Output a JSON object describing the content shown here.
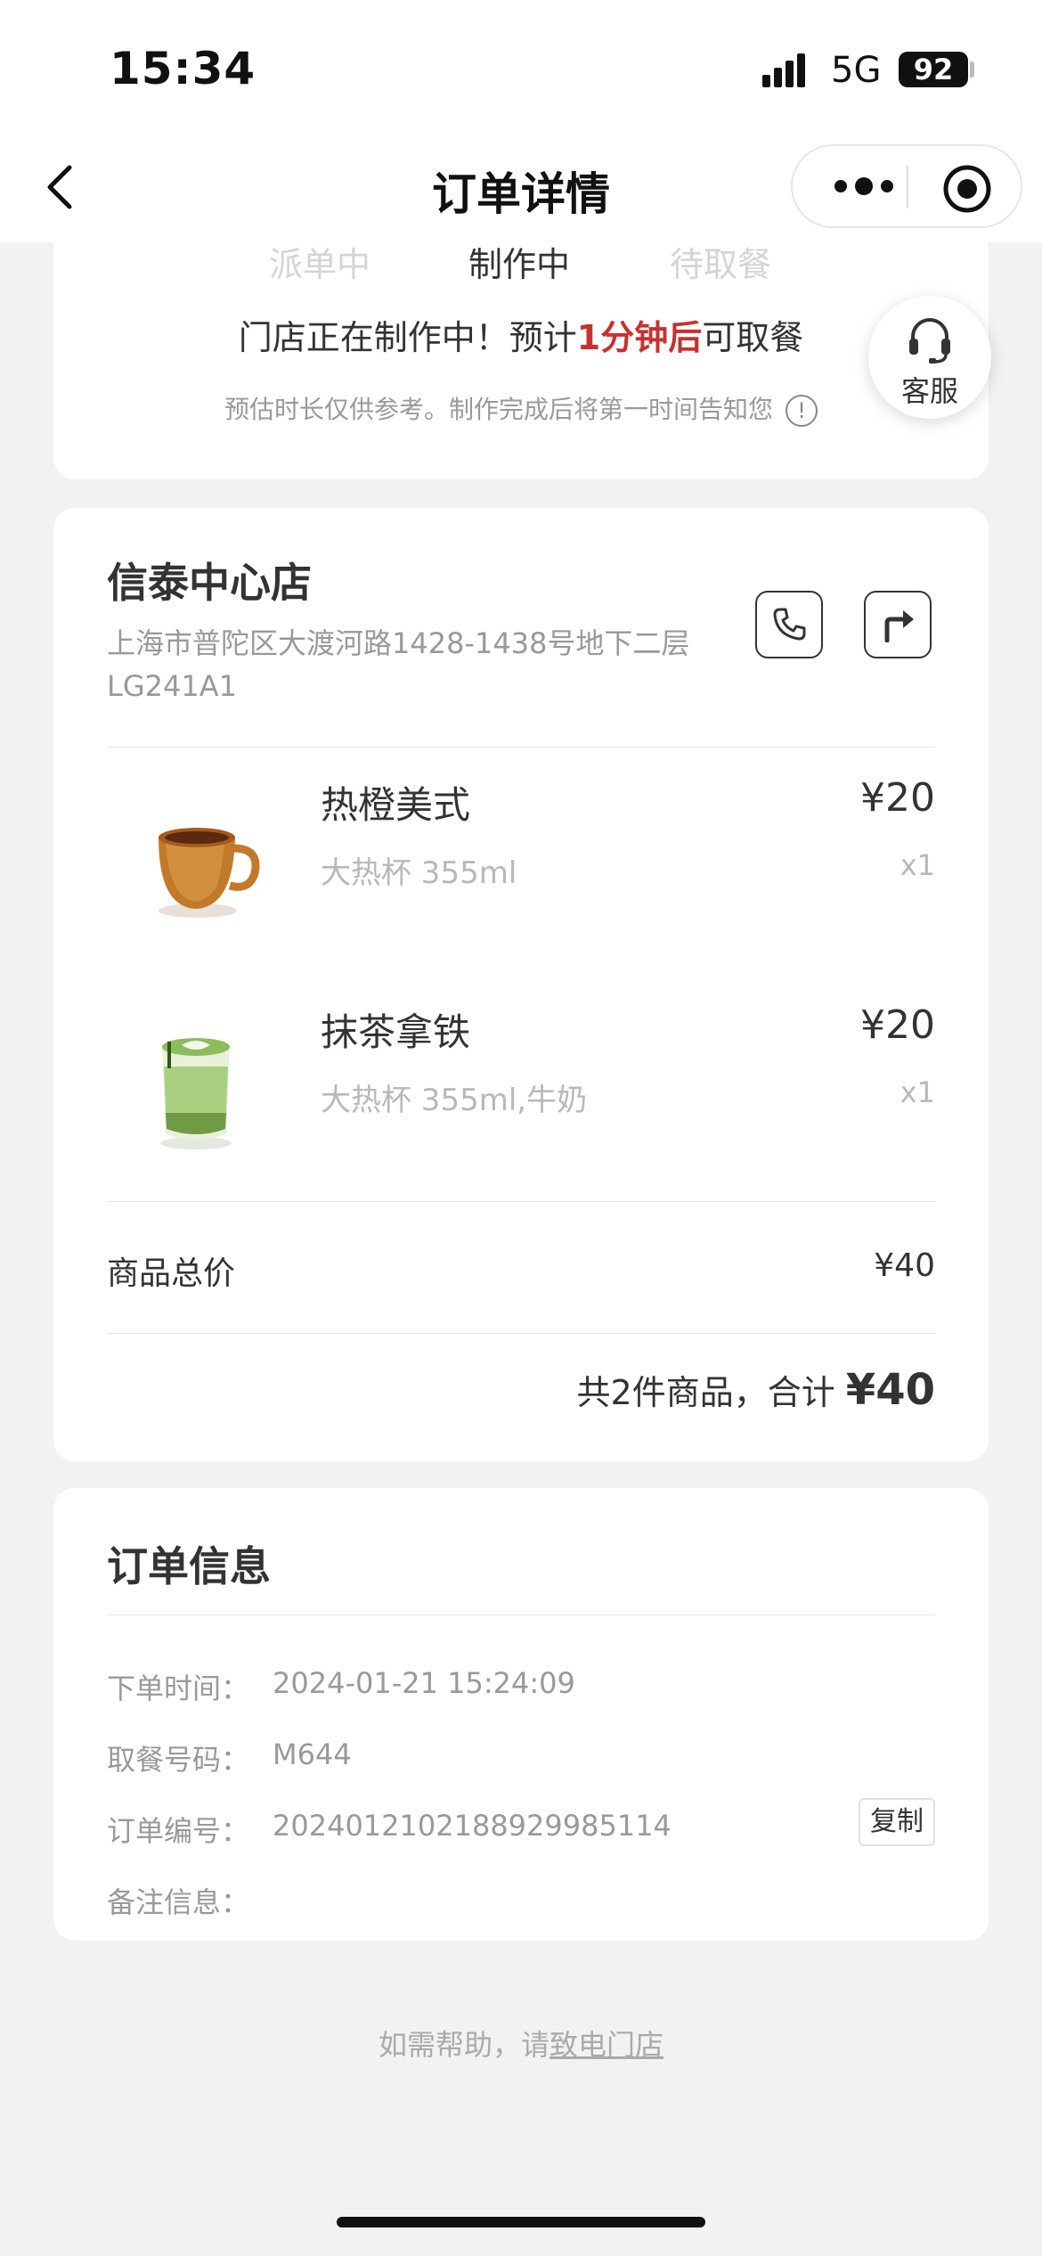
{
  "status_bar": {
    "time": "15:34",
    "network": "5G",
    "battery": "92"
  },
  "nav": {
    "title": "订单详情"
  },
  "progress": {
    "steps": [
      "派单中",
      "制作中",
      "待取餐"
    ],
    "message_prefix": "门店正在制作中！预计",
    "message_highlight": "1分钟后",
    "message_suffix": "可取餐",
    "note": "预估时长仅供参考。制作完成后将第一时间告知您",
    "info_icon": "!"
  },
  "customer_service": {
    "label": "客服"
  },
  "store": {
    "name": "信泰中心店",
    "address": "上海市普陀区大渡河路1428-1438号地下二层LG241A1"
  },
  "items": [
    {
      "name": "热橙美式",
      "spec": "大热杯 355ml",
      "price": "¥20",
      "qty": "x1"
    },
    {
      "name": "抹茶拿铁",
      "spec": "大热杯 355ml,牛奶",
      "price": "¥20",
      "qty": "x1"
    }
  ],
  "summary": {
    "subtotal_label": "商品总价",
    "subtotal_value": "¥40",
    "total_prefix": "共2件商品，合计",
    "total_value": "¥40"
  },
  "order_info": {
    "title": "订单信息",
    "rows": [
      {
        "label": "下单时间：",
        "value": "2024-01-21 15:24:09"
      },
      {
        "label": "取餐号码：",
        "value": "M644"
      },
      {
        "label": "订单编号：",
        "value": "2024012102188929985114"
      },
      {
        "label": "备注信息：",
        "value": ""
      }
    ],
    "copy_label": "复制"
  },
  "help": {
    "prefix": "如需帮助，请",
    "link": "致电门店"
  },
  "colors": {
    "highlight": "#c8312f",
    "background": "#f2f2f2",
    "card": "#ffffff"
  }
}
